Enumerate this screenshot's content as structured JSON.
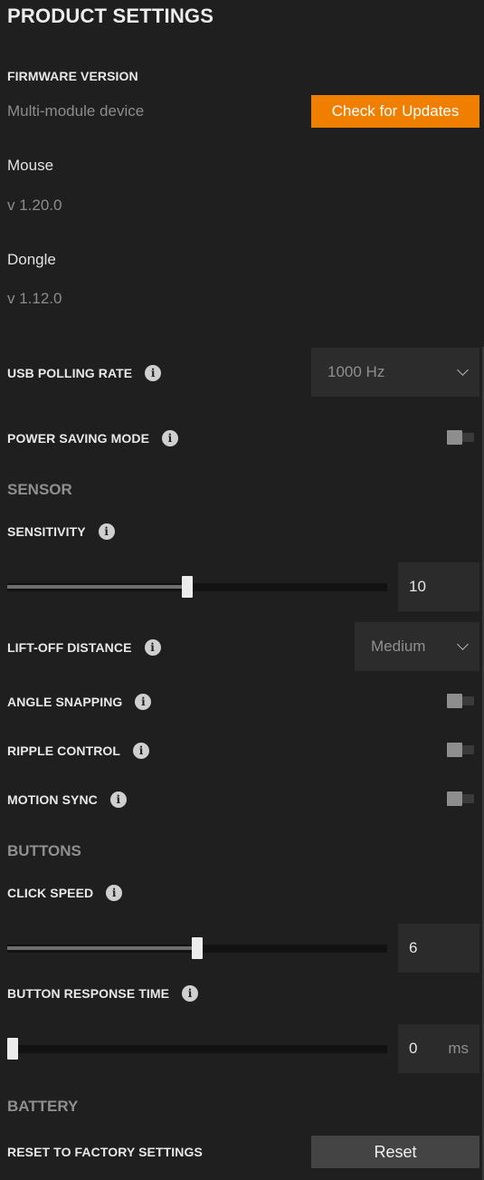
{
  "title": "PRODUCT SETTINGS",
  "firmware": {
    "label": "FIRMWARE VERSION",
    "device_type": "Multi-module device",
    "check_button": "Check for Updates",
    "modules": [
      {
        "name": "Mouse",
        "version": "v 1.20.0"
      },
      {
        "name": "Dongle",
        "version": "v 1.12.0"
      }
    ]
  },
  "usb_polling": {
    "label": "USB POLLING RATE",
    "value": "1000 Hz"
  },
  "power_saving": {
    "label": "POWER SAVING MODE",
    "enabled": false
  },
  "sensor": {
    "heading": "SENSOR",
    "sensitivity": {
      "label": "SENSITIVITY",
      "value": "10",
      "fraction": 0.474
    },
    "lift_off": {
      "label": "LIFT-OFF DISTANCE",
      "value": "Medium"
    },
    "angle_snapping": {
      "label": "ANGLE SNAPPING",
      "enabled": false
    },
    "ripple_control": {
      "label": "RIPPLE CONTROL",
      "enabled": false
    },
    "motion_sync": {
      "label": "MOTION SYNC",
      "enabled": false
    }
  },
  "buttons": {
    "heading": "BUTTONS",
    "click_speed": {
      "label": "CLICK SPEED",
      "value": "6",
      "fraction": 0.5
    },
    "response_time": {
      "label": "BUTTON RESPONSE TIME",
      "value": "0",
      "unit": "ms",
      "fraction": 0.0
    }
  },
  "battery": {
    "heading": "BATTERY",
    "reset_label": "RESET TO FACTORY SETTINGS",
    "reset_button": "Reset"
  },
  "icons": {
    "info": "info-icon",
    "chevron": "chevron-down-icon"
  },
  "colors": {
    "accent": "#f07f00",
    "background": "#1f1f1f"
  }
}
